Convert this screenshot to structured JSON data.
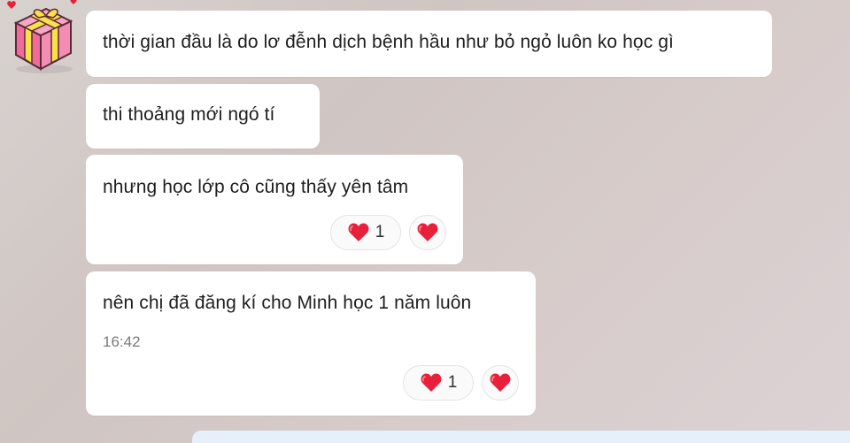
{
  "conversation": {
    "messages": [
      {
        "text": "thời gian đầu là do lơ đễnh dịch  bệnh hầu như bỏ ngỏ luôn ko học gì"
      },
      {
        "text": "thi thoảng mới ngó tí"
      },
      {
        "text": "nhưng học lớp cô cũng thấy yên tâm",
        "reaction": {
          "icon": "heart-icon",
          "count": "1"
        }
      },
      {
        "text": "nên chị đã đăng kí cho Minh học 1 năm luôn",
        "time": "16:42",
        "reaction": {
          "icon": "heart-icon",
          "count": "1"
        }
      }
    ]
  },
  "colors": {
    "bubble_incoming": "#ffffff",
    "bubble_outgoing": "#e6f0fb",
    "heart": "#e8213a",
    "avatar_box": "#f06b9c",
    "avatar_ribbon": "#f7e04a"
  }
}
